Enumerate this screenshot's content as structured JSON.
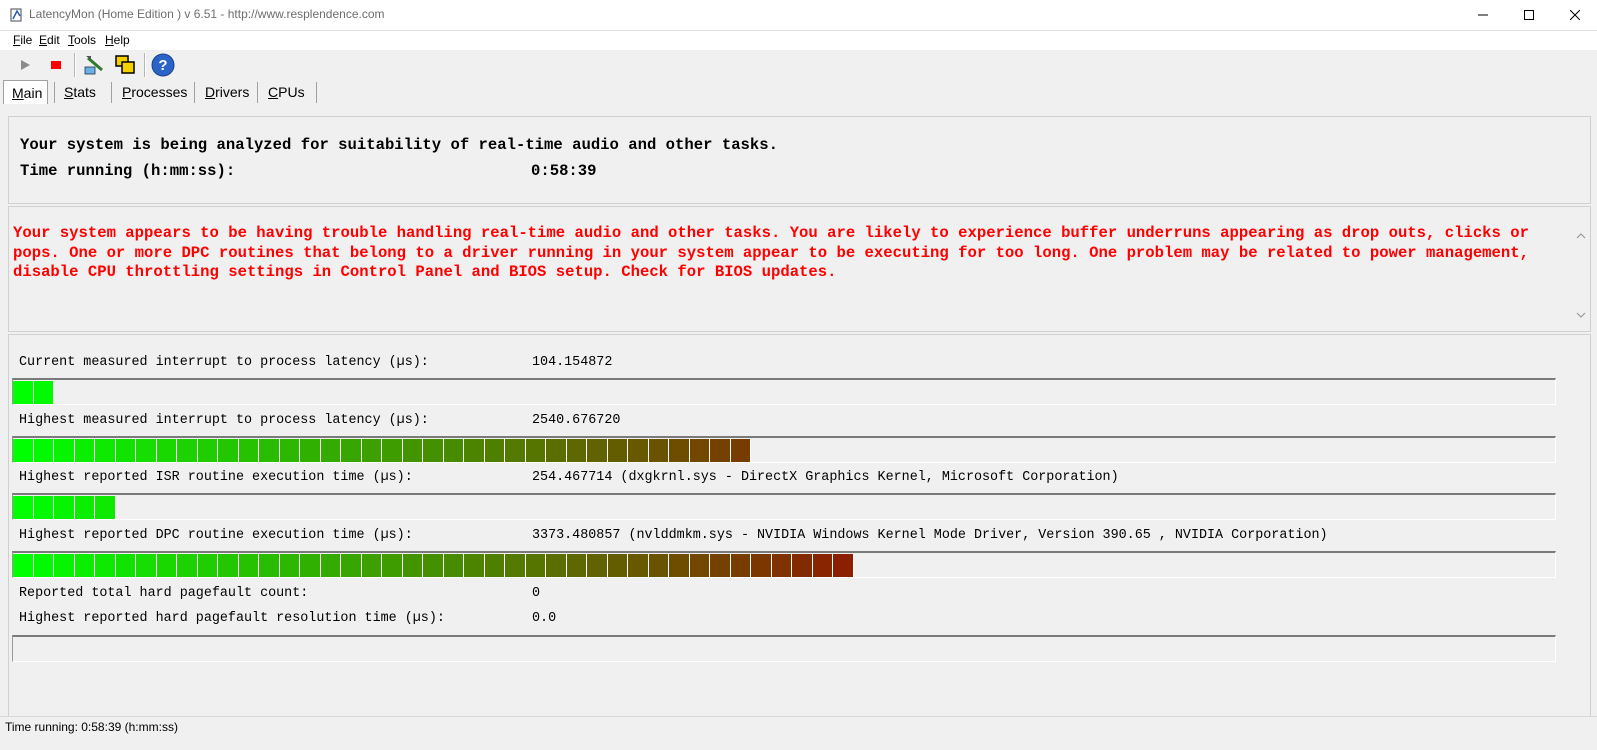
{
  "window": {
    "title": "LatencyMon  (Home Edition )  v 6.51 - http://www.resplendence.com",
    "minimize_icon": "minimize-icon",
    "maximize_icon": "maximize-icon",
    "close_icon": "close-icon"
  },
  "menu": {
    "items": [
      {
        "accel": "F",
        "rest": "ile"
      },
      {
        "accel": "E",
        "rest": "dit"
      },
      {
        "accel": "T",
        "rest": "ools"
      },
      {
        "accel": "H",
        "rest": "elp"
      }
    ]
  },
  "toolbar": {
    "icons": [
      "play-icon",
      "stop-icon",
      "tools-icon",
      "windows-icon",
      "help-icon"
    ],
    "colors": {
      "stop": "#ff0000",
      "play": "#8a8a8a",
      "help": "#2b64c8"
    }
  },
  "tabs": [
    {
      "accel": "M",
      "rest": "ain",
      "active": true
    },
    {
      "accel": "S",
      "rest": "tats",
      "active": false
    },
    {
      "accel": "P",
      "rest": "rocesses",
      "active": false
    },
    {
      "accel": "D",
      "rest": "rivers",
      "active": false
    },
    {
      "accel": "C",
      "rest": "PUs",
      "active": false
    }
  ],
  "status_panel": {
    "analyzing_text": "Your system is being analyzed for suitability of real-time audio and other tasks.",
    "time_label": "Time running (h:mm:ss):",
    "time_value": "0:58:39"
  },
  "verdict": {
    "text": "Your system appears to be having trouble handling real-time audio and other tasks. You are likely to experience buffer underruns appearing as drop outs, clicks or pops. One or more DPC routines that belong to a driver running in your system appear to be executing for too long. One problem may be related to power management, disable CPU throttling settings in Control Panel and BIOS setup. Check for BIOS updates.",
    "color": "#ff0000"
  },
  "measurements": {
    "current_latency": {
      "label": "Current measured interrupt to process latency (µs):",
      "value": "104.154872",
      "bar_segments": 2
    },
    "highest_latency": {
      "label": "Highest measured interrupt to process latency (µs):",
      "value": "2540.676720",
      "bar_segments": 36
    },
    "highest_isr": {
      "label": "Highest reported ISR routine execution time (µs):",
      "value": "254.467714",
      "detail": "(dxgkrnl.sys - DirectX Graphics Kernel, Microsoft Corporation)",
      "bar_segments": 5
    },
    "highest_dpc": {
      "label": "Highest reported DPC routine execution time (µs):",
      "value": "3373.480857",
      "detail": "(nvlddmkm.sys - NVIDIA Windows Kernel Mode Driver, Version 390.65 , NVIDIA Corporation)",
      "bar_segments": 41
    },
    "pagefault_count": {
      "label": "Reported total hard pagefault count:",
      "value": "0"
    },
    "pagefault_time": {
      "label": "Highest reported hard pagefault resolution time (µs):",
      "value": "0.0",
      "bar_segments": 0
    }
  },
  "bar_colors": {
    "start": "#00ff00",
    "end": "#8a2000",
    "divider": "#ffffff"
  },
  "statusbar": {
    "text": "Time running: 0:58:39  (h:mm:ss)"
  }
}
